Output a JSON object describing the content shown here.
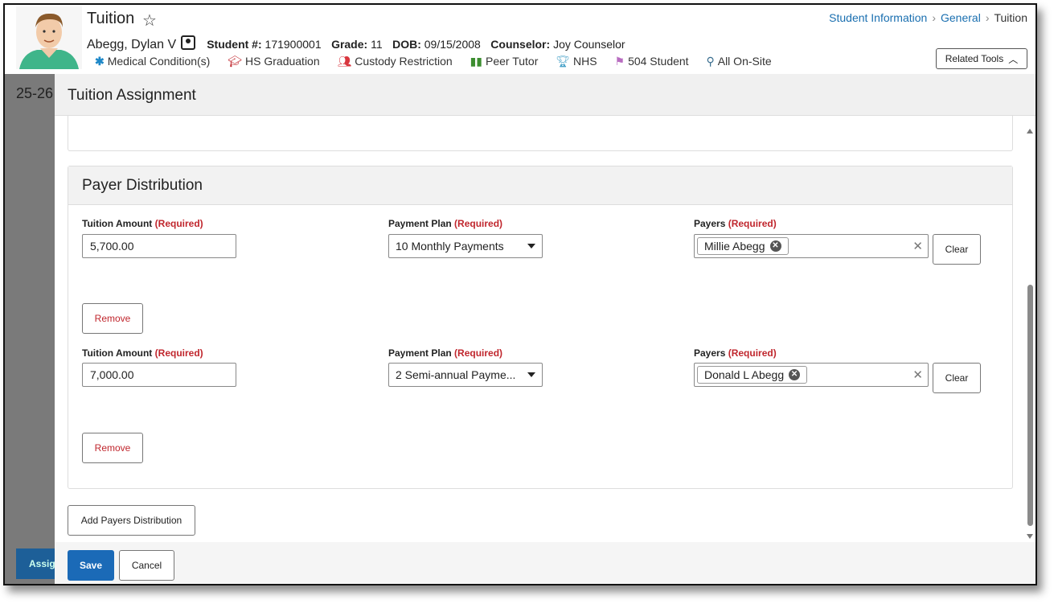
{
  "header": {
    "title": "Tuition",
    "student_name": "Abegg, Dylan V",
    "student_number_label": "Student #:",
    "student_number": "171900001",
    "grade_label": "Grade:",
    "grade": "11",
    "dob_label": "DOB:",
    "dob": "09/15/2008",
    "counselor_label": "Counselor:",
    "counselor": "Joy Counselor",
    "flags": [
      {
        "label": "Medical Condition(s)",
        "icon": "asterisk-icon",
        "color": "#1e88c8"
      },
      {
        "label": "HS Graduation",
        "icon": "graduation-cap-icon",
        "color": "#c0262d"
      },
      {
        "label": "Custody Restriction",
        "icon": "people-icon",
        "color": "#d9363e"
      },
      {
        "label": "Peer Tutor",
        "icon": "book-icon",
        "color": "#3c8d2f"
      },
      {
        "label": "NHS",
        "icon": "trophy-icon",
        "color": "#4aa3c9"
      },
      {
        "label": "504 Student",
        "icon": "flag-icon",
        "color": "#b86cc0"
      },
      {
        "label": "All On-Site",
        "icon": "person-onsite-icon",
        "color": "#3a6e8f"
      }
    ],
    "breadcrumb": [
      "Student Information",
      "General",
      "Tuition"
    ],
    "related_tools": "Related Tools"
  },
  "background": {
    "year": "25-26",
    "assign_button": "Assig"
  },
  "modal": {
    "title": "Tuition Assignment",
    "section_title": "Payer Distribution",
    "required_text": "(Required)",
    "tuition_amount_label": "Tuition Amount",
    "payment_plan_label": "Payment Plan",
    "payers_label": "Payers",
    "clear_label": "Clear",
    "remove_label": "Remove",
    "rows": [
      {
        "tuition_amount": "5,700.00",
        "payment_plan": "10 Monthly Payments",
        "payer": "Millie Abegg"
      },
      {
        "tuition_amount": "7,000.00",
        "payment_plan": "2 Semi-annual Payme...",
        "payer": "Donald L Abegg"
      }
    ],
    "add_payers_label": "Add Payers Distribution",
    "save_label": "Save",
    "cancel_label": "Cancel"
  },
  "colors": {
    "link": "#1a6fb0",
    "required": "#c0262d",
    "primary_button": "#1b6ab7"
  }
}
